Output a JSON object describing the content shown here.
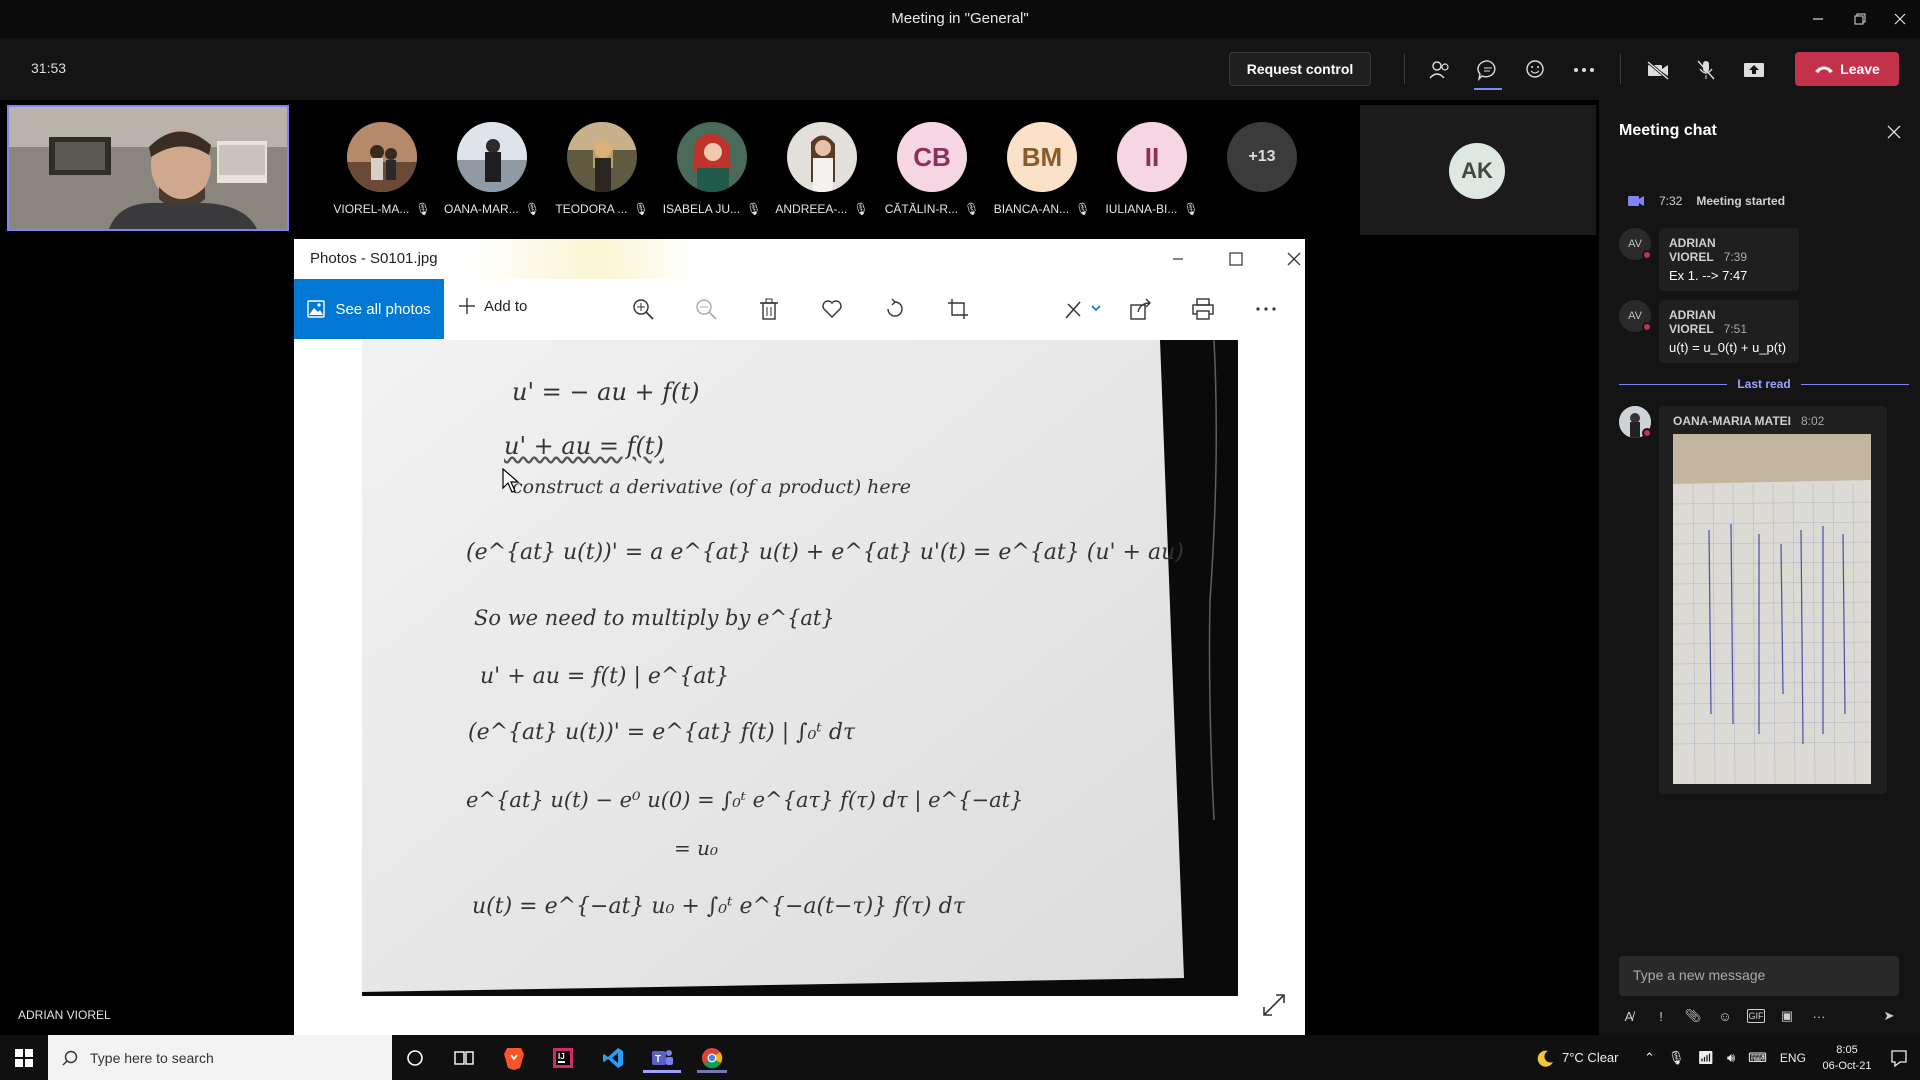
{
  "window": {
    "title": "Meeting in \"General\""
  },
  "meeting": {
    "timer": "31:53",
    "request_control": "Request control",
    "leave": "Leave",
    "current_speaker": "ADRIAN VIOREL"
  },
  "participants": [
    {
      "name": "VIOREL-MA...",
      "initials": "",
      "color": "#7a5a48"
    },
    {
      "name": "OANA-MAR...",
      "initials": "",
      "color": "#c9cfd6"
    },
    {
      "name": "TEODORA ...",
      "initials": "",
      "color": "#b69068"
    },
    {
      "name": "ISABELA JU...",
      "initials": "",
      "color": "#a8463f"
    },
    {
      "name": "ANDREEA-...",
      "initials": "",
      "color": "#d8d3cf"
    },
    {
      "name": "CĂTĂLIN-R...",
      "initials": "CB",
      "color": "#f7d6e3"
    },
    {
      "name": "BIANCA-AN...",
      "initials": "BM",
      "color": "#fbe1c7"
    },
    {
      "name": "IULIANA-BI...",
      "initials": "II",
      "color": "#f7d6e3"
    }
  ],
  "overflow_count": "+13",
  "spotlight_initials": "AK",
  "photos": {
    "title": "Photos - S0101.jpg",
    "see_all": "See all photos",
    "add_to": "Add to",
    "equations": [
      "u' = − au + f(t)",
      "u' + au  =  f(t)",
      "construct a derivative (of a product) here",
      "(e^{at} u(t))' = a e^{at} u(t) + e^{at} u'(t) = e^{at} (u' + au)",
      "So we need to multiply by e^{at}",
      "u' + au = f(t)  | e^{at}",
      "(e^{at} u(t))' = e^{at} f(t)   | ∫₀ᵗ dτ",
      "e^{at} u(t) − e⁰ u(0) = ∫₀ᵗ e^{aτ} f(τ) dτ  | e^{−at}",
      "= u₀",
      "u(t) = e^{−at} u₀ + ∫₀ᵗ e^{−a(t−τ)} f(τ) dτ"
    ]
  },
  "chat": {
    "title": "Meeting chat",
    "system_time": "7:32",
    "system_text": "Meeting started",
    "messages": [
      {
        "initials": "AV",
        "author": "ADRIAN VIOREL",
        "time": "7:39",
        "text": "Ex 1. --> 7:47"
      },
      {
        "initials": "AV",
        "author": "ADRIAN VIOREL",
        "time": "7:51",
        "text": "u(t) = u_0(t) + u_p(t)"
      }
    ],
    "last_read": "Last read",
    "photo_message": {
      "author": "OANA-MARIA MATEI",
      "time": "8:02"
    },
    "compose_placeholder": "Type a new message"
  },
  "taskbar": {
    "search_placeholder": "Type here to search",
    "weather": "7°C  Clear",
    "language": "ENG",
    "time": "8:05",
    "date": "06-Oct-21"
  },
  "colors": {
    "accent": "#7f85f5",
    "leave": "#c4314b",
    "photos_accent": "#0078d4"
  }
}
